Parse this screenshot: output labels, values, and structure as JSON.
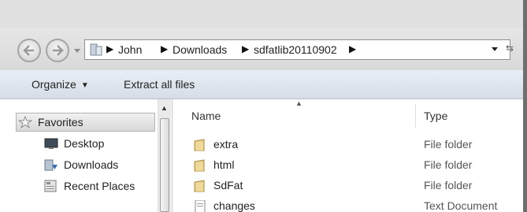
{
  "navigation": {
    "back_icon": "back-arrow-icon",
    "forward_icon": "forward-arrow-icon",
    "breadcrumb": [
      "John",
      "Downloads",
      "sdfatlib20110902"
    ]
  },
  "toolbar": {
    "organize_label": "Organize",
    "extract_label": "Extract all files"
  },
  "nav_pane": {
    "favorites_label": "Favorites",
    "items": [
      {
        "label": "Desktop",
        "icon": "desktop-icon"
      },
      {
        "label": "Downloads",
        "icon": "downloads-icon"
      },
      {
        "label": "Recent Places",
        "icon": "recent-places-icon"
      }
    ]
  },
  "file_list": {
    "columns": {
      "name": "Name",
      "type": "Type"
    },
    "rows": [
      {
        "name": "extra",
        "type": "File folder",
        "icon": "folder-icon"
      },
      {
        "name": "html",
        "type": "File folder",
        "icon": "folder-icon"
      },
      {
        "name": "SdFat",
        "type": "File folder",
        "icon": "folder-icon"
      },
      {
        "name": "changes",
        "type": "Text Document",
        "icon": "text-document-icon"
      }
    ]
  },
  "colors": {
    "toolbar_bg": "#dfe4ea",
    "selection_bg": "#e4e4e4",
    "folder": "#d9c07a"
  }
}
